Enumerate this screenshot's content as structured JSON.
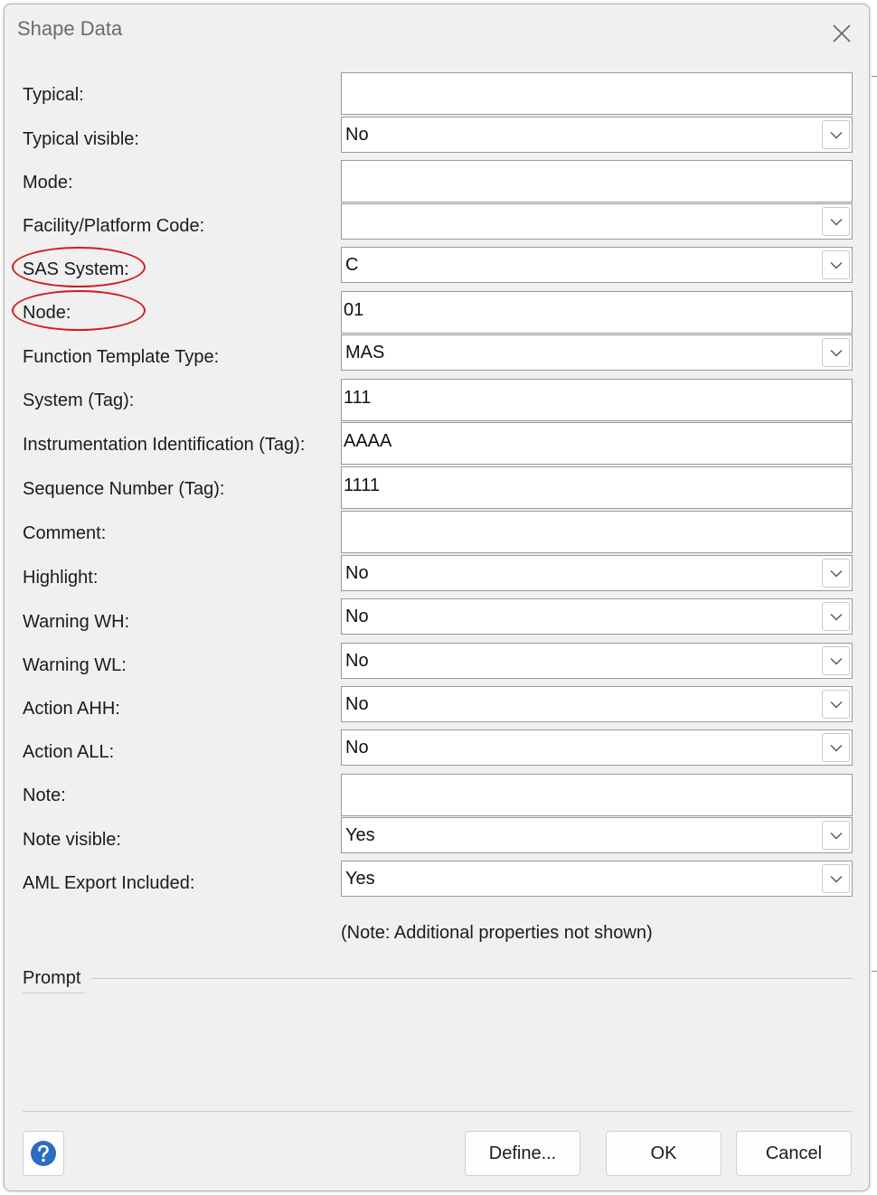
{
  "dialog": {
    "title": "Shape Data",
    "fields": [
      {
        "label": "Typical:",
        "type": "text",
        "value": ""
      },
      {
        "label": "Typical visible:",
        "type": "combo",
        "value": "No"
      },
      {
        "label": "Mode:",
        "type": "text",
        "value": ""
      },
      {
        "label": "Facility/Platform Code:",
        "type": "combo",
        "value": ""
      },
      {
        "label": "SAS System:",
        "type": "combo",
        "value": "C",
        "highlighted": true
      },
      {
        "label": "Node:",
        "type": "text",
        "value": "01",
        "highlighted": true
      },
      {
        "label": "Function Template Type:",
        "type": "combo",
        "value": "MAS"
      },
      {
        "label": "System (Tag):",
        "type": "text",
        "value": "111"
      },
      {
        "label": "Instrumentation Identification (Tag):",
        "type": "text",
        "value": "AAAA"
      },
      {
        "label": "Sequence Number (Tag):",
        "type": "text",
        "value": "1111"
      },
      {
        "label": "Comment:",
        "type": "text",
        "value": ""
      },
      {
        "label": "Highlight:",
        "type": "combo",
        "value": "No"
      },
      {
        "label": "Warning WH:",
        "type": "combo",
        "value": "No"
      },
      {
        "label": "Warning WL:",
        "type": "combo",
        "value": "No"
      },
      {
        "label": "Action AHH:",
        "type": "combo",
        "value": "No"
      },
      {
        "label": "Action ALL:",
        "type": "combo",
        "value": "No"
      },
      {
        "label": "Note:",
        "type": "text",
        "value": ""
      },
      {
        "label": "Note visible:",
        "type": "combo",
        "value": "Yes"
      },
      {
        "label": "AML Export Included:",
        "type": "combo",
        "value": "Yes"
      }
    ],
    "note": "(Note: Additional properties not shown)",
    "prompt_label": "Prompt",
    "buttons": {
      "define": "Define...",
      "ok": "OK",
      "cancel": "Cancel"
    },
    "highlight_color": "#d21c1c",
    "help_icon_color": "#2b6cc4"
  }
}
